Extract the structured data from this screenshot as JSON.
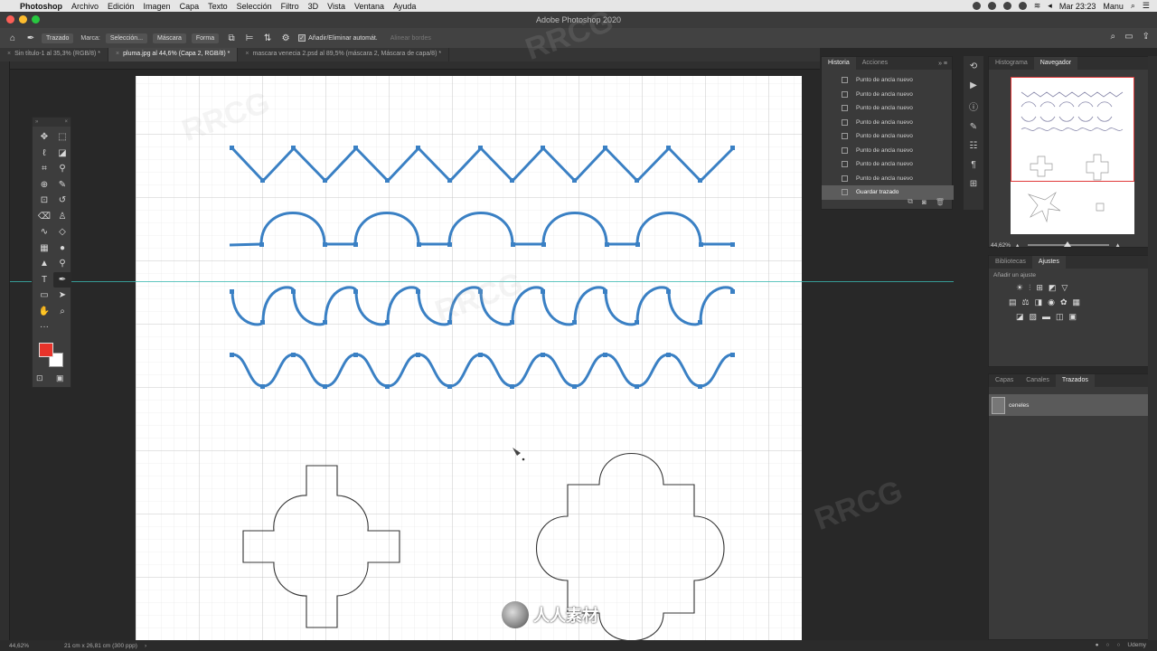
{
  "menubar": {
    "app": "Photoshop",
    "items": [
      "Archivo",
      "Edición",
      "Imagen",
      "Capa",
      "Texto",
      "Selección",
      "Filtro",
      "3D",
      "Vista",
      "Ventana",
      "Ayuda"
    ],
    "clock": "Mar 23:23",
    "user": "Manu"
  },
  "window": {
    "title": "Adobe Photoshop 2020"
  },
  "options": {
    "mode": "Trazado",
    "make_label": "Marca:",
    "selection": "Selección...",
    "mask": "Máscara",
    "shape": "Forma",
    "auto_add_delete": "Añadir/Eliminar automát.",
    "align_edges": "Alinear bordes"
  },
  "tabs": [
    {
      "label": "Sin título-1 al 35,3% (RGB/8) *"
    },
    {
      "label": "pluma.jpg al 44,6% (Capa 2, RGB/8) *"
    },
    {
      "label": "mascara venecia 2.psd al 89,5% (máscara 2, Máscara de capa/8) *"
    }
  ],
  "history": {
    "tabs": [
      "Historia",
      "Acciones"
    ],
    "items": [
      "Punto de ancla nuevo",
      "Punto de ancla nuevo",
      "Punto de ancla nuevo",
      "Punto de ancla nuevo",
      "Punto de ancla nuevo",
      "Punto de ancla nuevo",
      "Punto de ancla nuevo",
      "Punto de ancla nuevo",
      "Guardar trazado"
    ]
  },
  "navigator": {
    "tabs": [
      "Histograma",
      "Navegador"
    ],
    "zoom": "44,62%"
  },
  "adjustments": {
    "tabs": [
      "Bibliotecas",
      "Ajustes"
    ],
    "hint": "Añadir un ajuste"
  },
  "paths_panel": {
    "tabs": [
      "Capas",
      "Canales",
      "Trazados"
    ],
    "path_name": "ceneles"
  },
  "status": {
    "zoom": "44,62%",
    "doc_size": "21 cm x 26,81 cm (300 ppp)"
  },
  "watermark": {
    "text": "人人素材",
    "brand": "RRCG",
    "udemy": "Udemy"
  },
  "colors": {
    "path_blue": "#3a80c4",
    "foreground": "#e8332a",
    "guide": "#39b8b0"
  }
}
